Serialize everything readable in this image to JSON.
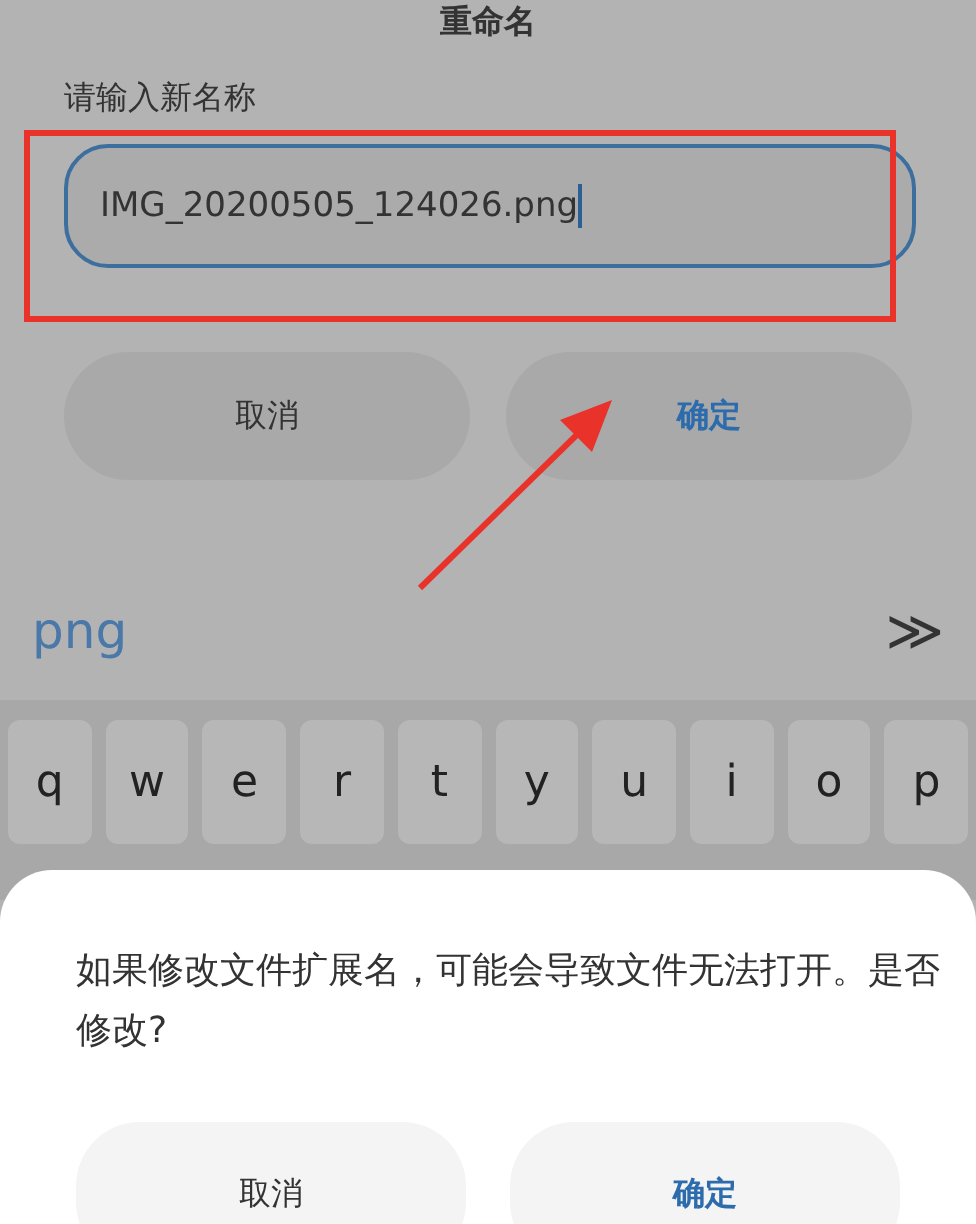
{
  "rename_dialog": {
    "title": "重命名",
    "label": "请输入新名称",
    "value": "IMG_20200505_124026.png",
    "buttons": [
      {
        "label": "取消",
        "kind": "cancel"
      },
      {
        "label": "确定",
        "kind": "confirm"
      }
    ]
  },
  "suggestion_bar": {
    "suggestion": "png",
    "expand": "≫"
  },
  "keyboard": {
    "keys": [
      "q",
      "w",
      "e",
      "r",
      "t",
      "y",
      "u",
      "i",
      "o",
      "p"
    ]
  },
  "warning_sheet": {
    "message": "如果修改文件扩展名，可能会导致文件无法打开。是否修改?",
    "buttons": [
      {
        "label": "取消",
        "kind": "cancel"
      },
      {
        "label": "确定",
        "kind": "confirm"
      }
    ]
  }
}
